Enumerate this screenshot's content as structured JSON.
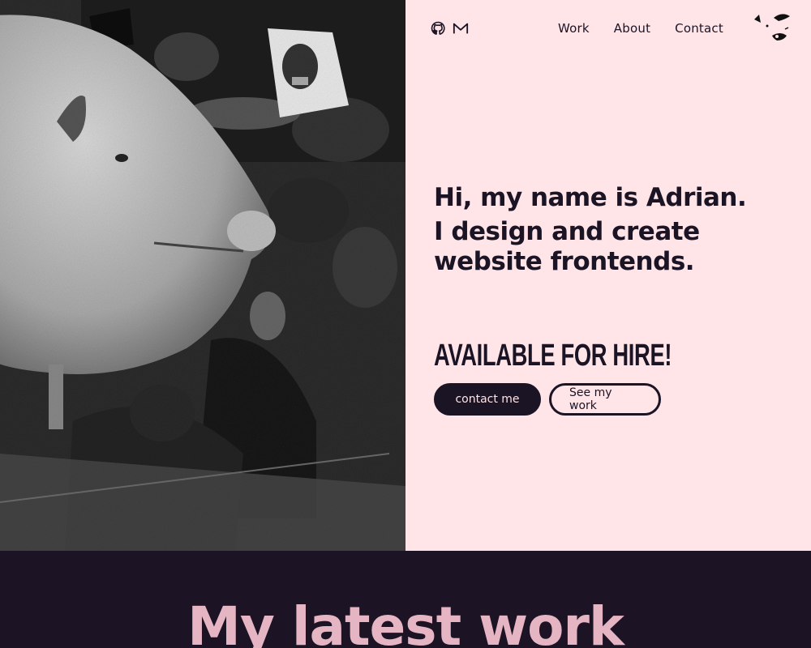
{
  "header": {
    "icons": [
      {
        "name": "github-icon"
      },
      {
        "name": "mail-icon"
      }
    ],
    "nav": [
      {
        "label": "Work"
      },
      {
        "label": "About"
      },
      {
        "label": "Contact"
      }
    ],
    "logo": "abstract-face-logo"
  },
  "hero": {
    "image": "black-and-white protest photo with giant pig balloon",
    "greeting": "Hi, my name is Adrian.",
    "tagline": "I design and create website frontends.",
    "availability": "AVAILABLE FOR HIRE!",
    "primary_button": "contact me",
    "secondary_button": "See my work"
  },
  "work": {
    "title": "My latest work"
  },
  "colors": {
    "background_pink": "#ffe4e8",
    "dark": "#1c1424",
    "accent_pink": "#e6b5c4"
  }
}
